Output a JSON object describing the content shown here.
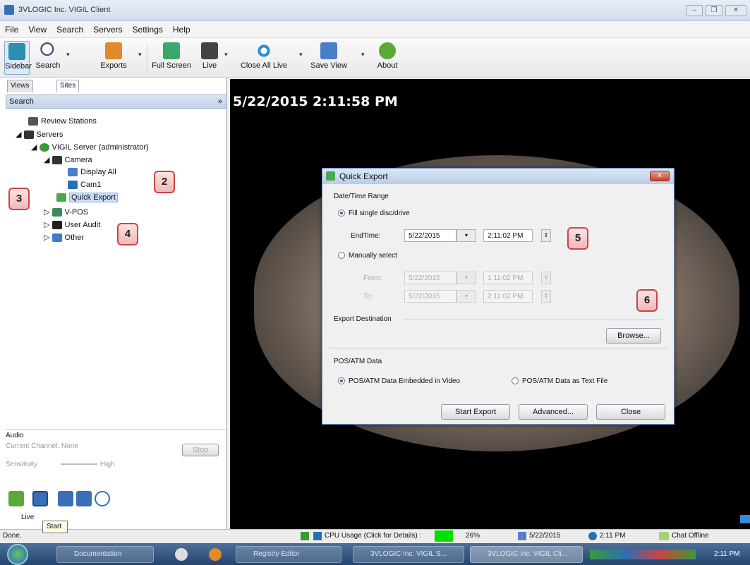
{
  "window": {
    "title": "3VLOGIC Inc. VIGIL Client",
    "buttons": [
      "–",
      "❐",
      "✕"
    ]
  },
  "menu": [
    "File",
    "View",
    "Search",
    "Servers",
    "Settings",
    "Help"
  ],
  "toolbar": {
    "sidebar": "Sidebar",
    "search": "Search",
    "exports": "Exports",
    "fullscreen": "Full Screen",
    "live": "Live",
    "close_all_live": "Close All Live",
    "save_view": "Save View",
    "about": "About"
  },
  "left": {
    "tabs": [
      "Views",
      "Sites"
    ],
    "search_label": "Search",
    "tree": {
      "review_stations": "Review Stations",
      "servers": "Servers",
      "vigil_server": "VIGIL Server (administrator)",
      "camera": "Camera",
      "display_all": "Display All",
      "cam1": "Cam1",
      "quick_export": "Quick Export",
      "vpos": "V-POS",
      "user_audit": "User Audit",
      "other": "Other"
    },
    "audio": {
      "title": "Audio",
      "channel": "Current Channel: None",
      "stop": "Stop",
      "sensitivity": "Sensitivity",
      "high": "High"
    },
    "live_label": "Live",
    "start_tooltip": "Start"
  },
  "callouts": [
    "2",
    "3",
    "4",
    "5",
    "6"
  ],
  "video": {
    "timestamp": "5/22/2015 2:11:58 PM"
  },
  "dialog": {
    "title": "Quick Export",
    "range_label": "Date/Time Range",
    "fill_single": "Fill single disc/drive",
    "endtime_label": "EndTime:",
    "endtime_date": "5/22/2015",
    "endtime_time": "2:11:02 PM",
    "manual": "Manually select",
    "from_label": "From:",
    "from_date": "5/22/2015",
    "from_time": "1:11:02 PM",
    "to_label": "To:",
    "to_date": "5/22/2015",
    "to_time": "2:11:02 PM",
    "dest_label": "Export Destination",
    "browse": "Browse...",
    "pos_label": "POS/ATM Data",
    "pos_embedded": "POS/ATM Data Embedded in Video",
    "pos_textfile": "POS/ATM Data as Text File",
    "start_export": "Start Export",
    "advanced": "Advanced...",
    "close": "Close"
  },
  "status": {
    "done": "Done.",
    "cpu": "CPU Usage (Click for Details) :",
    "cpu_pct": "26%",
    "date": "5/22/2015",
    "time": "2:11 PM",
    "chat": "Chat Offline"
  },
  "taskbar": {
    "items": [
      "Documentation",
      "Registry Editor",
      "3VLOGIC Inc. VIGIL S...",
      "3VLOGIC Inc. VIGIL Cli..."
    ],
    "clock": "2:11 PM"
  },
  "colors": {
    "accent": "#3a6fb5",
    "callout": "#c44444",
    "cpu_bar": "#00e000"
  }
}
